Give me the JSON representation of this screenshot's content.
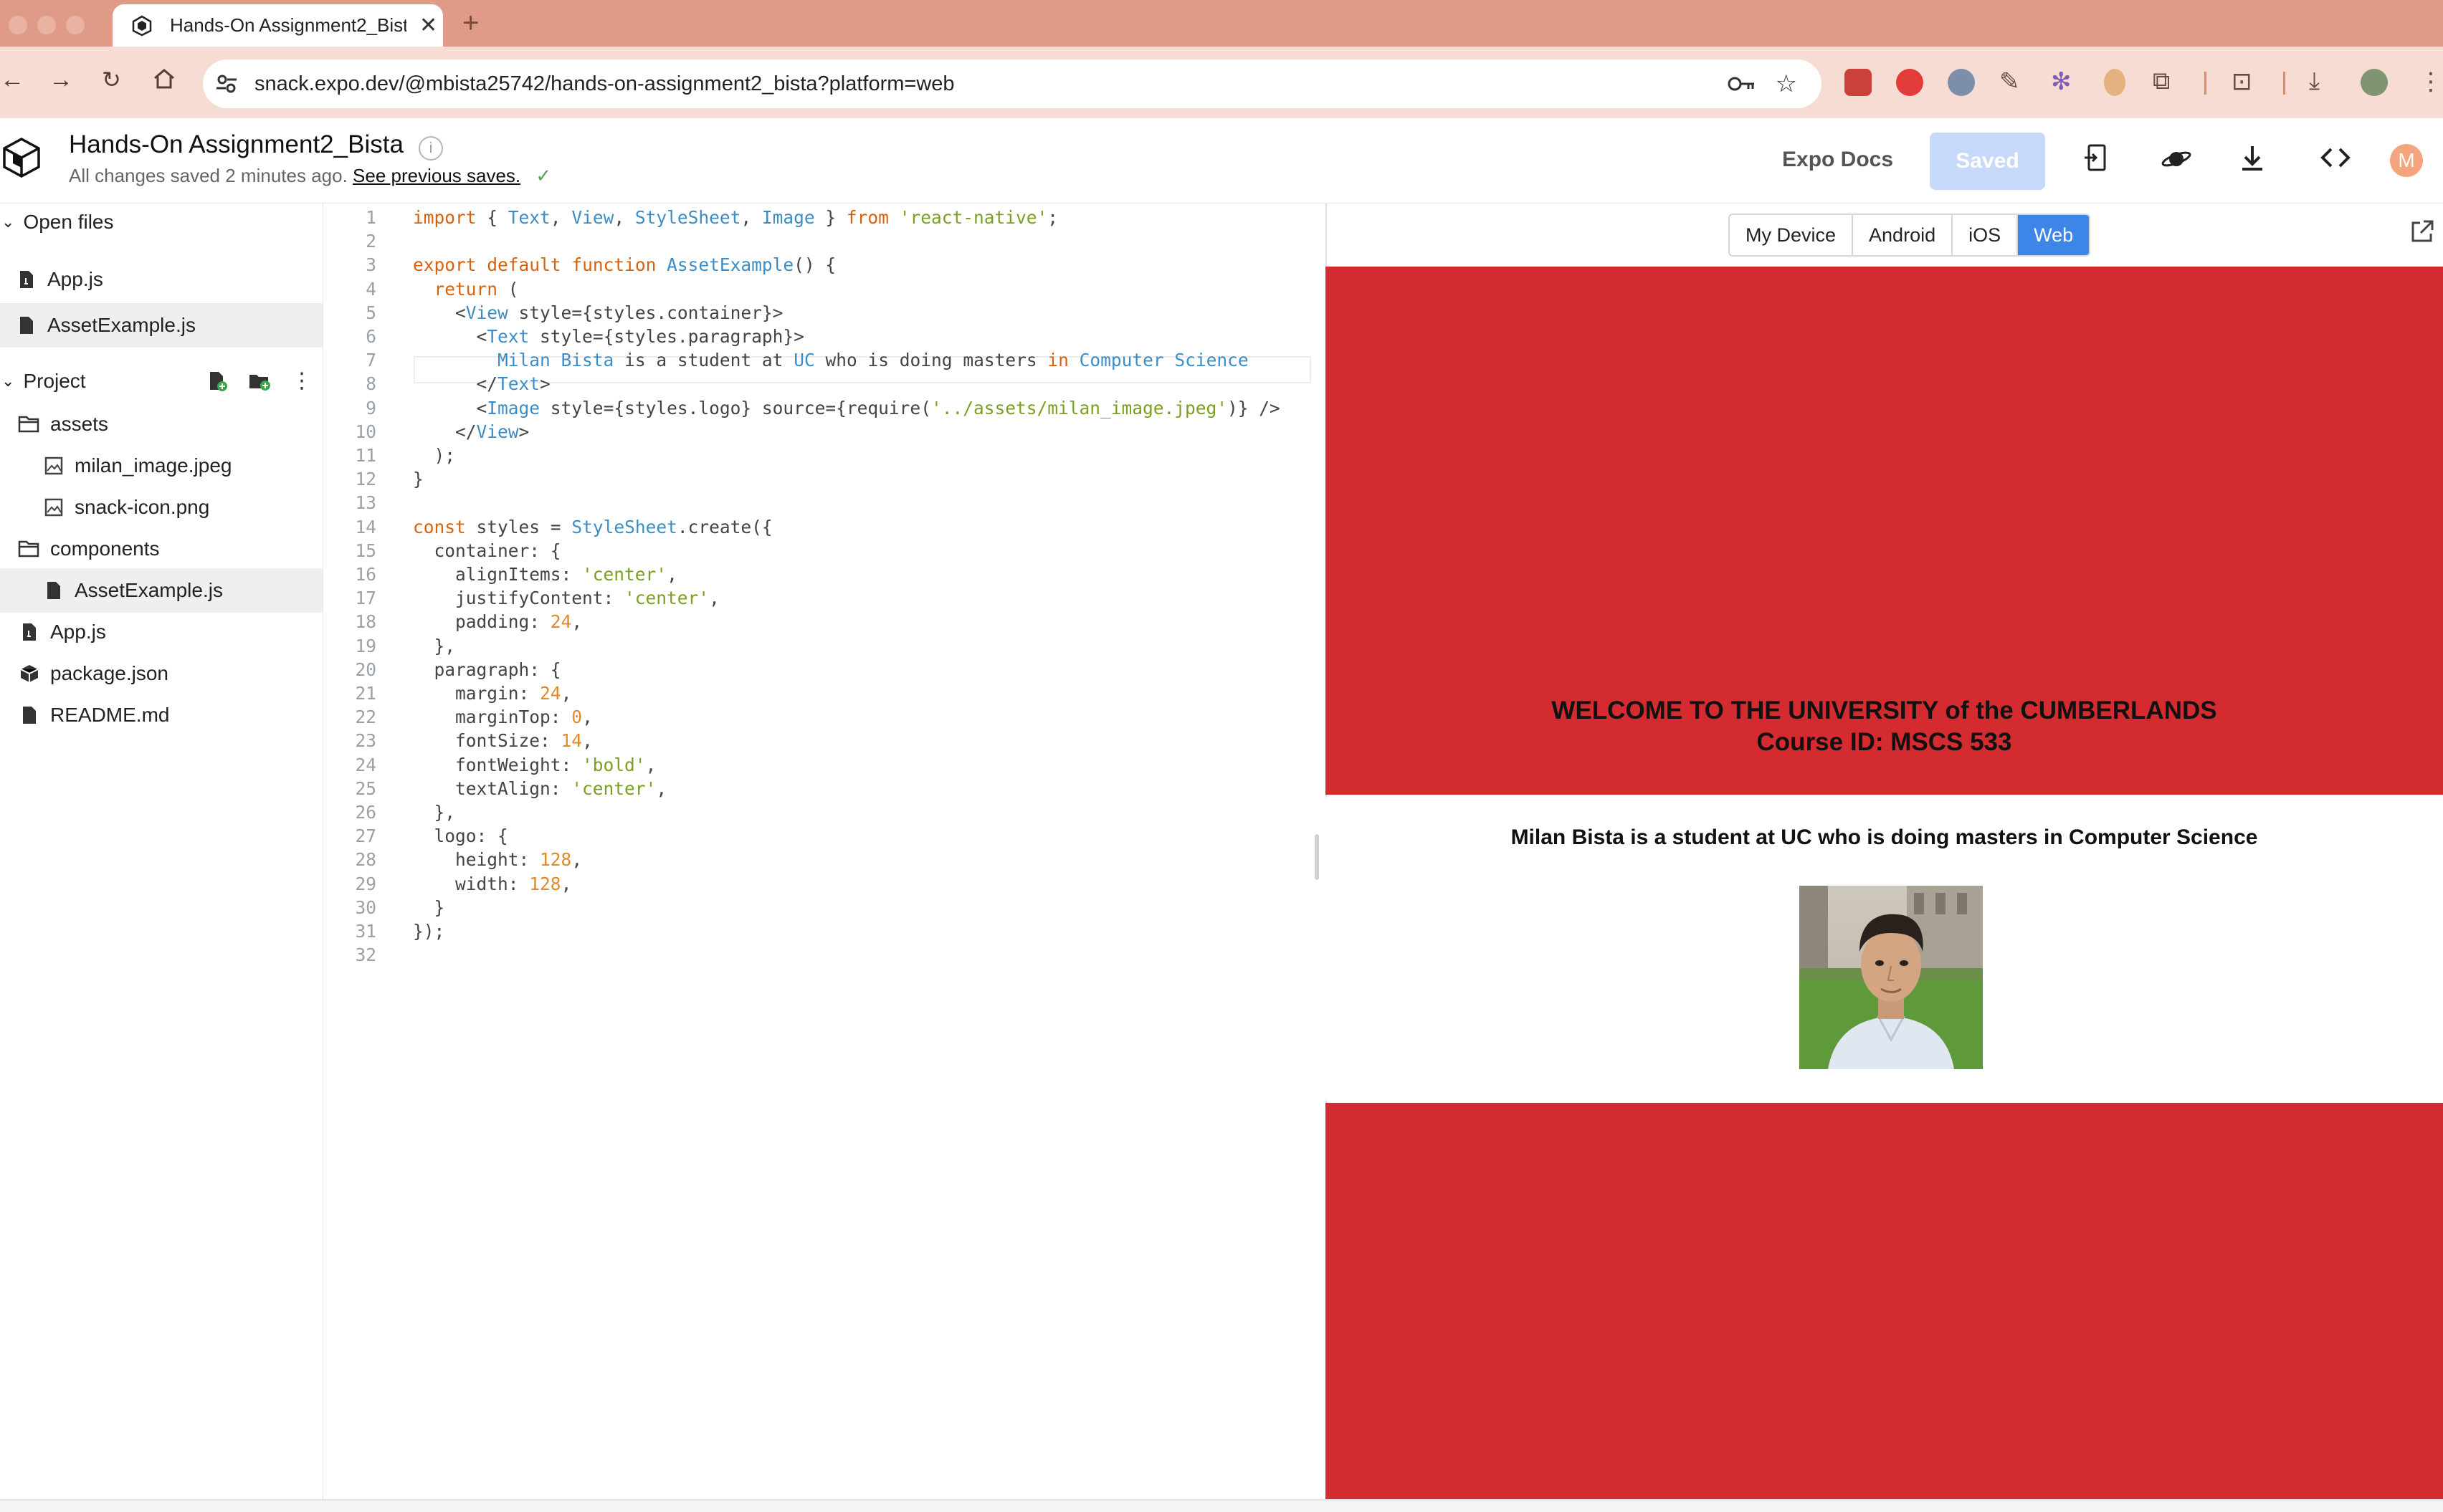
{
  "browser": {
    "tab_title": "Hands-On Assignment2_Bista",
    "url": "snack.expo.dev/@mbista25742/hands-on-assignment2_bista?platform=web"
  },
  "header": {
    "project_title": "Hands-On Assignment2_Bista",
    "saved_status": "All changes saved 2 minutes ago.",
    "previous_saves_link": "See previous saves.",
    "expo_docs": "Expo Docs",
    "saved_button": "Saved",
    "avatar_initial": "M"
  },
  "sidebar": {
    "open_files_label": "Open files",
    "open_files": [
      "App.js",
      "AssetExample.js"
    ],
    "project_label": "Project",
    "tree": {
      "assets": "assets",
      "milan_image": "milan_image.jpeg",
      "snack_icon": "snack-icon.png",
      "components": "components",
      "asset_example": "AssetExample.js",
      "app_js": "App.js",
      "package_json": "package.json",
      "readme": "README.md"
    }
  },
  "editor": {
    "lines": [
      "import { Text, View, StyleSheet, Image } from 'react-native';",
      "",
      "export default function AssetExample() {",
      "  return (",
      "    <View style={styles.container}>",
      "      <Text style={styles.paragraph}>",
      "        Milan Bista is a student at UC who is doing masters in Computer Science",
      "      </Text>",
      "      <Image style={styles.logo} source={require('../assets/milan_image.jpeg')} />",
      "    </View>",
      "  );",
      "}",
      "",
      "const styles = StyleSheet.create({",
      "  container: {",
      "    alignItems: 'center',",
      "    justifyContent: 'center',",
      "    padding: 24,",
      "  },",
      "  paragraph: {",
      "    margin: 24,",
      "    marginTop: 0,",
      "    fontSize: 14,",
      "    fontWeight: 'bold',",
      "    textAlign: 'center',",
      "  },",
      "  logo: {",
      "    height: 128,",
      "    width: 128,",
      "  }",
      "});",
      ""
    ]
  },
  "preview": {
    "platform_tabs": [
      "My Device",
      "Android",
      "iOS",
      "Web"
    ],
    "active_platform": "Web",
    "welcome_line1": "WELCOME TO THE UNIVERSITY of the CUMBERLANDS",
    "welcome_line2": "Course ID: MSCS 533",
    "paragraph": "Milan Bista is a student at UC who is doing masters in Computer Science",
    "background_color": "#d32b2f"
  }
}
